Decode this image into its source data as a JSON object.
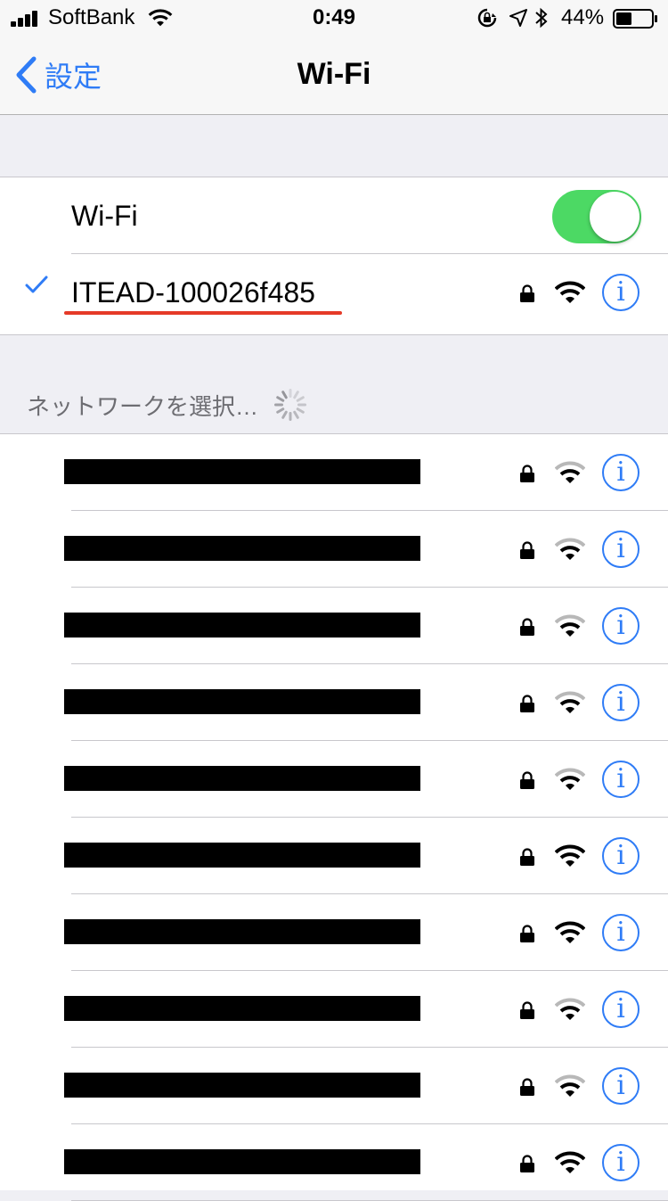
{
  "status_bar": {
    "carrier": "SoftBank",
    "time": "0:49",
    "battery": "44%"
  },
  "nav": {
    "back_label": "設定",
    "title": "Wi-Fi"
  },
  "wifi": {
    "label": "Wi-Fi",
    "enabled": true,
    "connected_network": "ITEAD-100026f485"
  },
  "networks_header": "ネットワークを選択…",
  "networks": [
    {
      "name": "",
      "secured": true,
      "strength": "weak"
    },
    {
      "name": "",
      "secured": true,
      "strength": "weak"
    },
    {
      "name": "",
      "secured": true,
      "strength": "weak"
    },
    {
      "name": "",
      "secured": true,
      "strength": "weak"
    },
    {
      "name": "",
      "secured": true,
      "strength": "weak"
    },
    {
      "name": "",
      "secured": true,
      "strength": "full"
    },
    {
      "name": "",
      "secured": true,
      "strength": "full"
    },
    {
      "name": "",
      "secured": true,
      "strength": "weak"
    },
    {
      "name": "",
      "secured": true,
      "strength": "weak"
    },
    {
      "name": "",
      "secured": true,
      "strength": "full"
    }
  ],
  "colors": {
    "accent": "#2f7cf6",
    "toggle_on": "#4cd964",
    "annotation": "#e53a28",
    "background": "#efeff4"
  },
  "icons": {
    "info": "i"
  }
}
